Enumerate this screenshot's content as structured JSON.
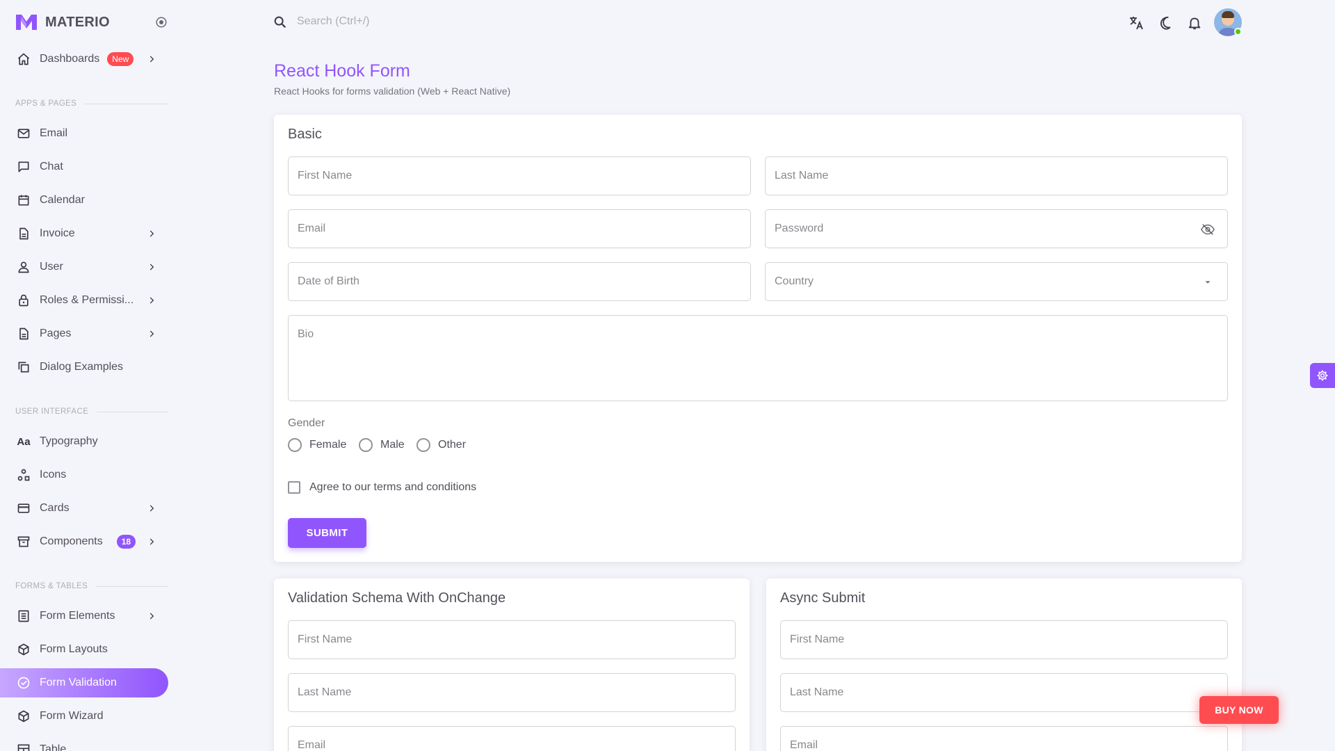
{
  "colors": {
    "primary": "#9155FD",
    "error": "#FF4C51",
    "success": "#56CA00",
    "background": "#F4F5FA"
  },
  "brand": {
    "name": "MATERIO",
    "logo_icon": "materio-logo"
  },
  "sidebar": {
    "dashboards": {
      "label": "Dashboards",
      "badge": "New"
    },
    "sections": {
      "apps_pages": "APPS & PAGES",
      "user_interface": "USER INTERFACE",
      "forms_tables": "FORMS & TABLES"
    },
    "items": {
      "email": "Email",
      "chat": "Chat",
      "calendar": "Calendar",
      "invoice": "Invoice",
      "user": "User",
      "roles": "Roles & Permissi...",
      "pages": "Pages",
      "dialog": "Dialog Examples",
      "typography": "Typography",
      "icons": "Icons",
      "cards": "Cards",
      "components": "Components",
      "components_badge": "18",
      "form_elements": "Form Elements",
      "form_layouts": "Form Layouts",
      "form_validation": "Form Validation",
      "form_wizard": "Form Wizard",
      "table": "Table"
    }
  },
  "topbar": {
    "search_placeholder": "Search (Ctrl+/)"
  },
  "page": {
    "title": "React Hook Form",
    "subtitle": "React Hooks for forms validation (Web + React Native)"
  },
  "basic": {
    "title": "Basic",
    "first_name": "First Name",
    "last_name": "Last Name",
    "email": "Email",
    "password": "Password",
    "dob": "Date of Birth",
    "country": "Country",
    "bio": "Bio",
    "gender_label": "Gender",
    "gender_options": [
      "Female",
      "Male",
      "Other"
    ],
    "terms": "Agree to our terms and conditions",
    "submit": "SUBMIT"
  },
  "schema": {
    "title": "Validation Schema With OnChange",
    "first_name": "First Name",
    "last_name": "Last Name",
    "email": "Email"
  },
  "async": {
    "title": "Async Submit",
    "first_name": "First Name",
    "last_name": "Last Name",
    "email": "Email"
  },
  "buy_now": "BUY NOW"
}
